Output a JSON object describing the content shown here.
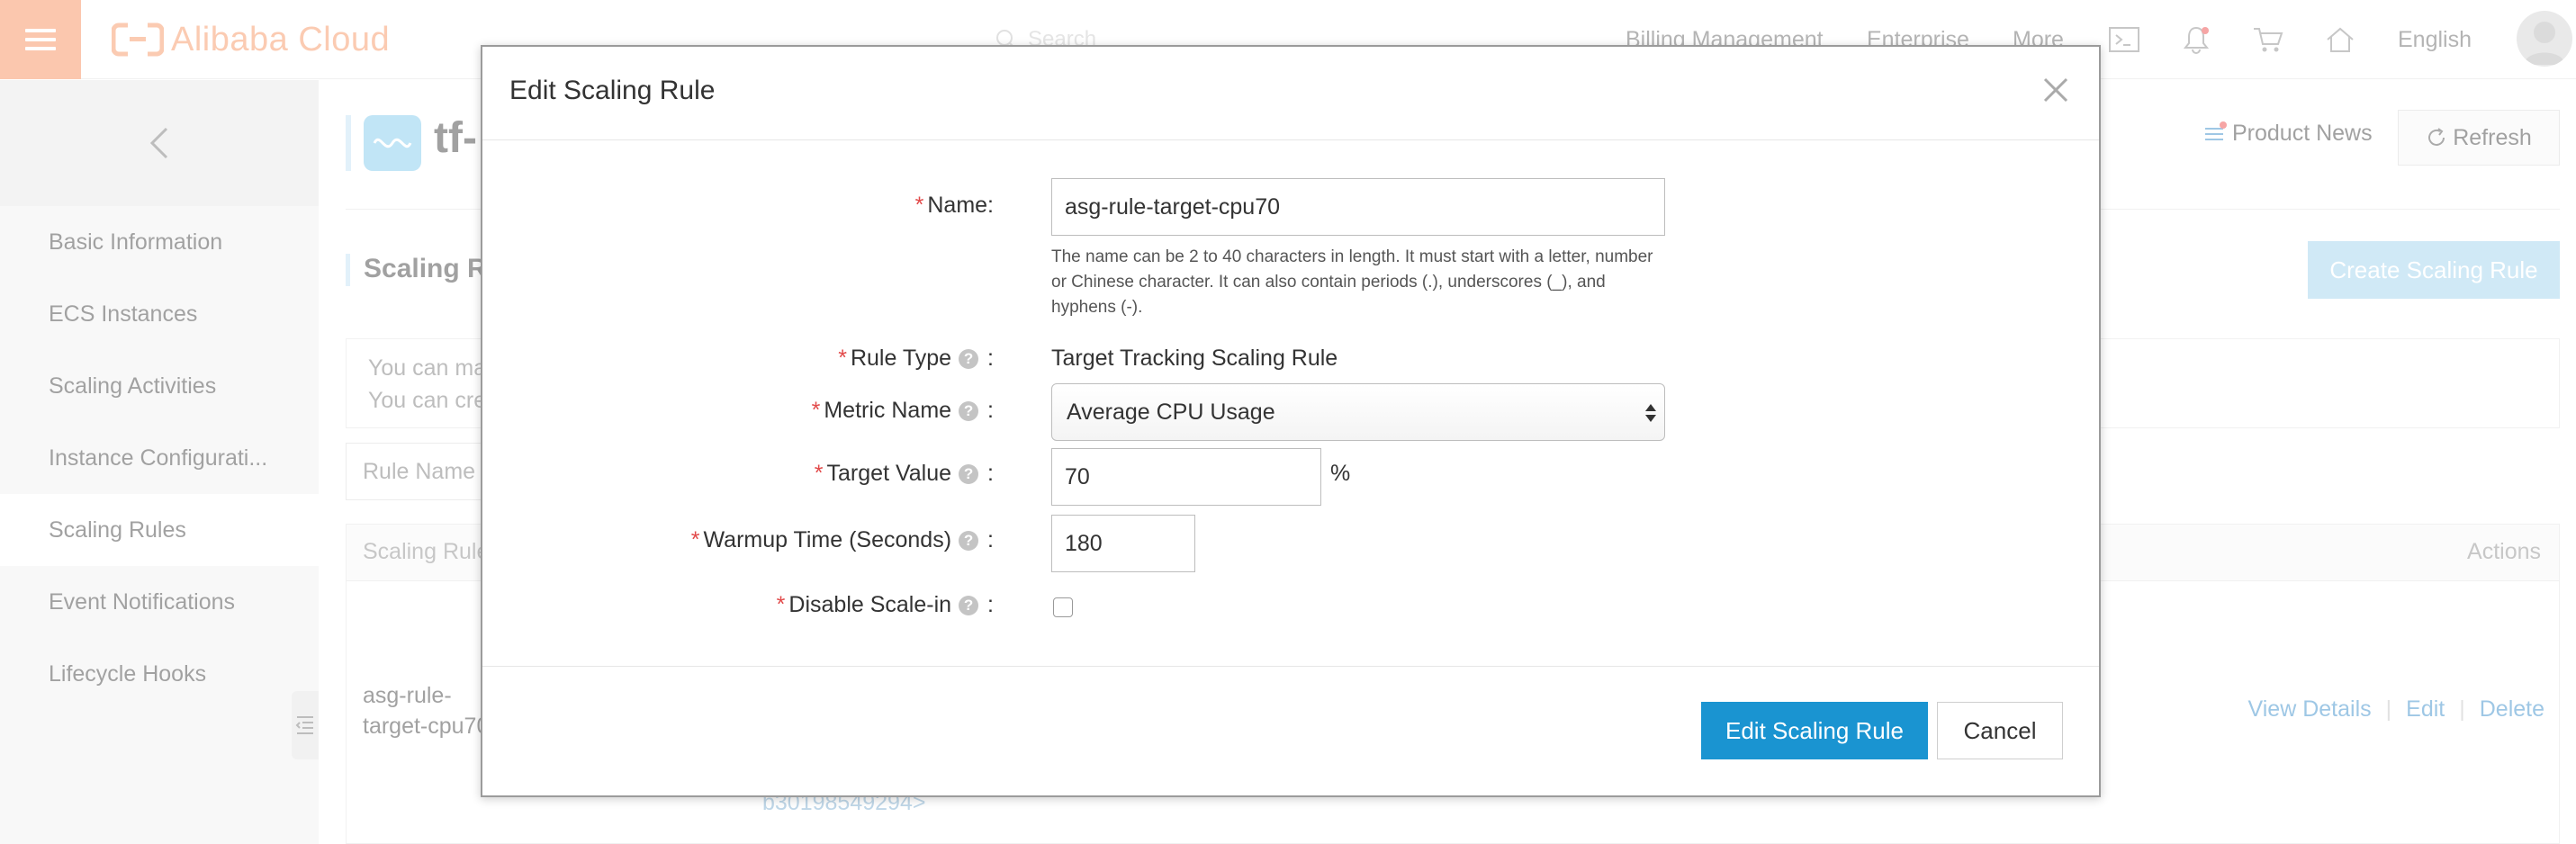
{
  "topbar": {
    "brand": "Alibaba Cloud",
    "search_placeholder": "Search",
    "nav": [
      "Billing Management",
      "Enterprise",
      "More"
    ],
    "language": "English",
    "accent_color": "#f79a6c"
  },
  "sidebar": {
    "items": [
      {
        "label": "Basic Information"
      },
      {
        "label": "ECS Instances"
      },
      {
        "label": "Scaling Activities"
      },
      {
        "label": "Instance Configurati..."
      },
      {
        "label": "Scaling Rules",
        "active": true
      },
      {
        "label": "Event Notifications"
      },
      {
        "label": "Lifecycle Hooks"
      }
    ]
  },
  "main": {
    "title": "tf-",
    "section_title": "Scaling Ru",
    "product_news": "Product News",
    "refresh": "Refresh",
    "create_button": "Create Scaling Rule",
    "info_line1": "You can ma",
    "info_line2": "You can cre",
    "filter_label": "Rule Name",
    "table_header_first": "Scaling Rule",
    "table_header_actions": "Actions",
    "row": {
      "name": "asg-rule-target-cpu70",
      "id_fragment": "b30198549294>",
      "actions": [
        "View Details",
        "Edit",
        "Delete"
      ]
    }
  },
  "modal": {
    "title": "Edit Scaling Rule",
    "fields": {
      "name_label": "Name:",
      "name_value": "asg-rule-target-cpu70",
      "name_hint": "The name can be 2 to 40 characters in length. It must start with a letter, number or Chinese character. It can also contain periods (.), underscores (_), and hyphens (-).",
      "rule_type_label": "Rule Type",
      "rule_type_value": "Target Tracking Scaling Rule",
      "metric_label": "Metric Name",
      "metric_value": "Average CPU Usage",
      "target_label": "Target Value",
      "target_value": "70",
      "target_unit": "%",
      "warmup_label": "Warmup Time (Seconds)",
      "warmup_value": "180",
      "disable_label": "Disable Scale-in",
      "disable_checked": false
    },
    "submit_label": "Edit Scaling Rule",
    "cancel_label": "Cancel"
  }
}
